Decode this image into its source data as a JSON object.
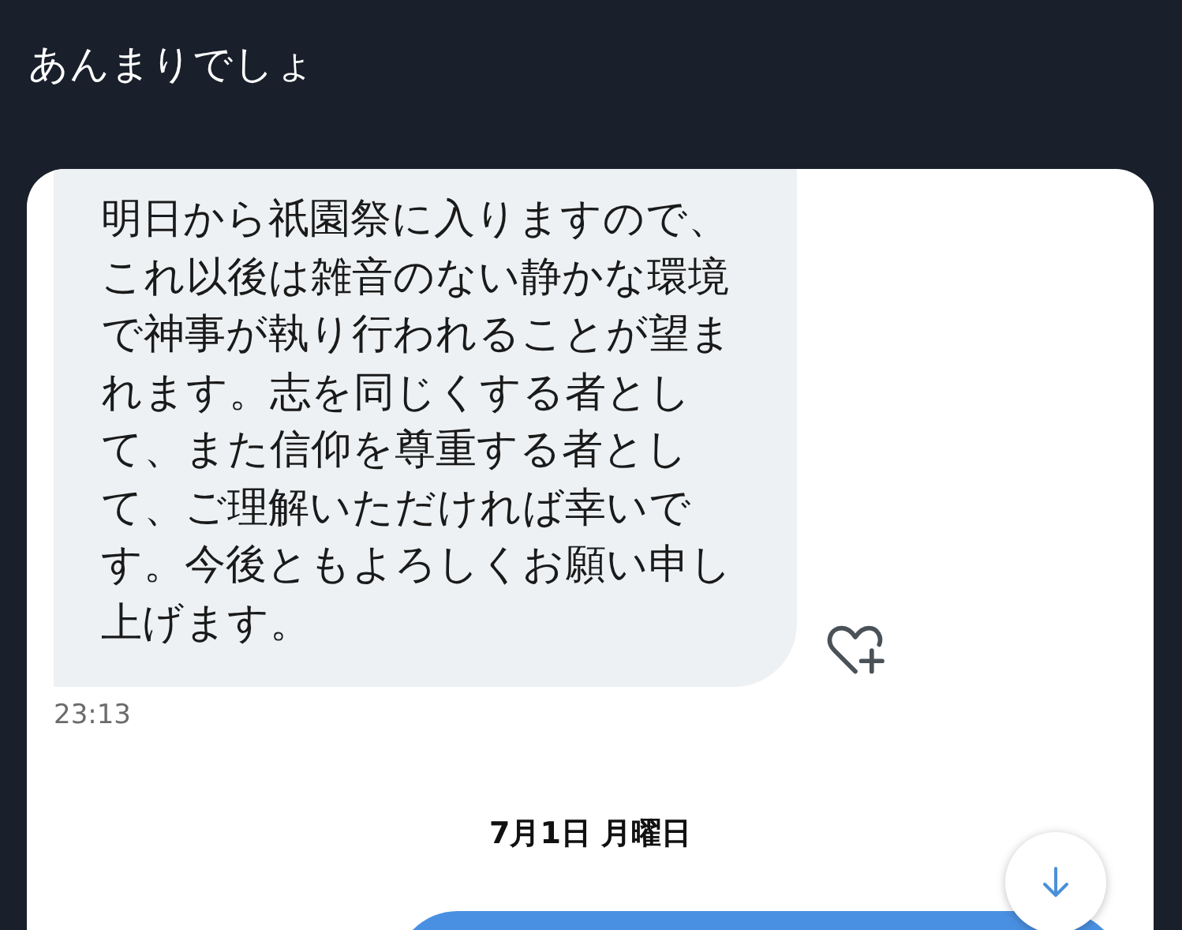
{
  "header": {
    "title": "あんまりでしょ"
  },
  "messages": [
    {
      "text": "明日から祇園祭に入りますので、これ以後は雑音のない静かな環境で神事が執り行われることが望まれます。志を同じくする者として、また信仰を尊重する者として、ご理解いただければ幸いです。今後ともよろしくお願い申し上げます。",
      "time": "23:13"
    }
  ],
  "date_divider": "7月1日 月曜日"
}
